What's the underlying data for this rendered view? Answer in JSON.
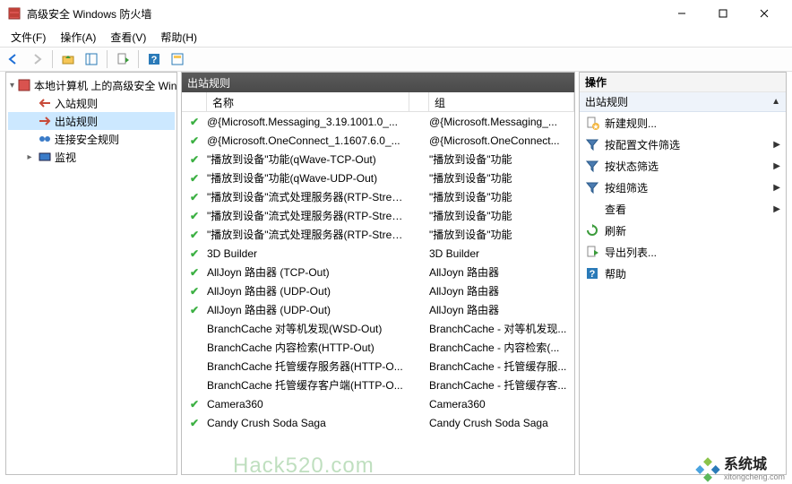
{
  "window": {
    "title": "高级安全 Windows 防火墙"
  },
  "menu": {
    "file": "文件(F)",
    "action": "操作(A)",
    "view": "查看(V)",
    "help": "帮助(H)"
  },
  "tree": {
    "root": "本地计算机 上的高级安全 Win",
    "inbound": "入站规则",
    "outbound": "出站规则",
    "connsec": "连接安全规则",
    "monitor": "监视"
  },
  "center": {
    "title": "出站规则",
    "col_name": "名称",
    "col_group": "组",
    "rows": [
      {
        "on": true,
        "name": "@{Microsoft.Messaging_3.19.1001.0_...",
        "group": "@{Microsoft.Messaging_..."
      },
      {
        "on": true,
        "name": "@{Microsoft.OneConnect_1.1607.6.0_...",
        "group": "@{Microsoft.OneConnect..."
      },
      {
        "on": true,
        "name": "\"播放到设备\"功能(qWave-TCP-Out)",
        "group": "\"播放到设备\"功能"
      },
      {
        "on": true,
        "name": "\"播放到设备\"功能(qWave-UDP-Out)",
        "group": "\"播放到设备\"功能"
      },
      {
        "on": true,
        "name": "\"播放到设备\"流式处理服务器(RTP-Strea...",
        "group": "\"播放到设备\"功能"
      },
      {
        "on": true,
        "name": "\"播放到设备\"流式处理服务器(RTP-Strea...",
        "group": "\"播放到设备\"功能"
      },
      {
        "on": true,
        "name": "\"播放到设备\"流式处理服务器(RTP-Strea...",
        "group": "\"播放到设备\"功能"
      },
      {
        "on": true,
        "name": "3D Builder",
        "group": "3D Builder"
      },
      {
        "on": true,
        "name": "AllJoyn 路由器 (TCP-Out)",
        "group": "AllJoyn 路由器"
      },
      {
        "on": true,
        "name": "AllJoyn 路由器 (UDP-Out)",
        "group": "AllJoyn 路由器"
      },
      {
        "on": true,
        "name": "AllJoyn 路由器 (UDP-Out)",
        "group": "AllJoyn 路由器"
      },
      {
        "on": false,
        "name": "BranchCache 对等机发现(WSD-Out)",
        "group": "BranchCache - 对等机发现..."
      },
      {
        "on": false,
        "name": "BranchCache 内容检索(HTTP-Out)",
        "group": "BranchCache - 内容检索(..."
      },
      {
        "on": false,
        "name": "BranchCache 托管缓存服务器(HTTP-O...",
        "group": "BranchCache - 托管缓存服..."
      },
      {
        "on": false,
        "name": "BranchCache 托管缓存客户端(HTTP-O...",
        "group": "BranchCache - 托管缓存客..."
      },
      {
        "on": true,
        "name": "Camera360",
        "group": "Camera360"
      },
      {
        "on": true,
        "name": "Candy Crush Soda Saga",
        "group": "Candy Crush Soda Saga"
      }
    ]
  },
  "actions": {
    "title": "操作",
    "subtitle": "出站规则",
    "new_rule": "新建规则...",
    "filter_profile": "按配置文件筛选",
    "filter_state": "按状态筛选",
    "filter_group": "按组筛选",
    "view": "查看",
    "refresh": "刷新",
    "export": "导出列表...",
    "help": "帮助"
  },
  "watermark": {
    "hack": "Hack520.com",
    "brand": "系统城",
    "brand_sub": "xitongcheng.com"
  }
}
